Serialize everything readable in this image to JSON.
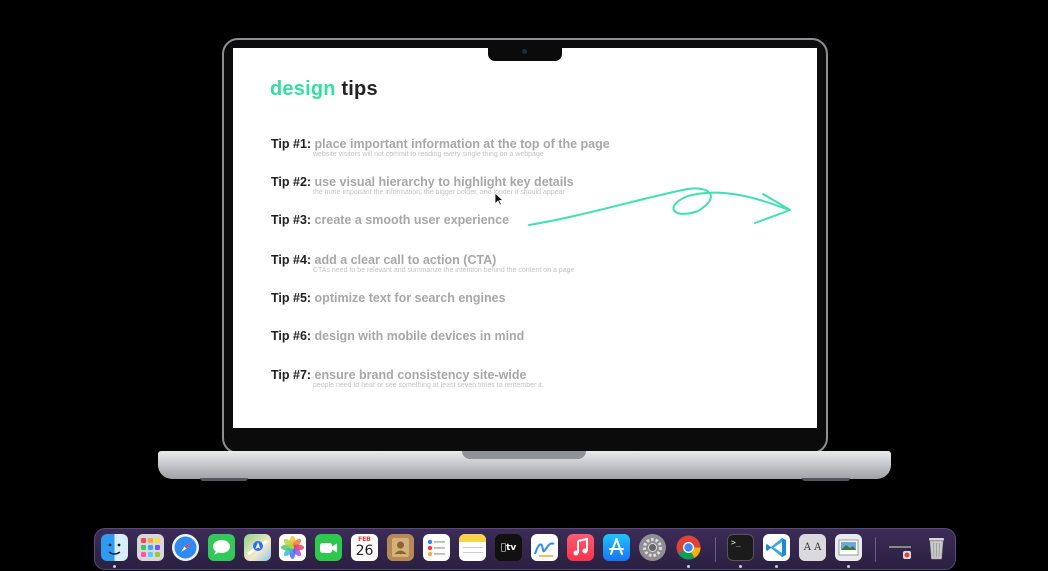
{
  "slide": {
    "title_accent": "design",
    "title_rest": "tips",
    "tips": [
      {
        "label": "Tip #1:",
        "text": "place important information at the top of the page",
        "sub": "website visitors will not commit to reading every single thing on a webpage"
      },
      {
        "label": "Tip #2:",
        "text": "use visual hierarchy to highlight key details",
        "sub": "the more important the information, the bigger bolder, and louder it should appear"
      },
      {
        "label": "Tip #3:",
        "text": "create a smooth user experience",
        "sub": ""
      },
      {
        "label": "Tip #4:",
        "text": "add a clear call to action (CTA)",
        "sub": "CTAs need to be relevant and summarize the intention behind the content on a page"
      },
      {
        "label": "Tip #5:",
        "text": "optimize text for search engines",
        "sub": ""
      },
      {
        "label": "Tip #6:",
        "text": "design with mobile devices in mind",
        "sub": ""
      },
      {
        "label": "Tip #7:",
        "text": "ensure brand consistency site-wide",
        "sub": "people need to hear or see something at least seven times to remember it."
      }
    ],
    "annotation_color": "#3fe0b2",
    "accent_color": "#34e0a0"
  },
  "dock": {
    "apps": [
      {
        "name": "finder-icon",
        "running": true
      },
      {
        "name": "launchpad-icon",
        "running": false
      },
      {
        "name": "safari-icon",
        "running": false
      },
      {
        "name": "messages-icon",
        "running": false
      },
      {
        "name": "maps-icon",
        "running": false
      },
      {
        "name": "photos-icon",
        "running": false
      },
      {
        "name": "facetime-icon",
        "running": false
      },
      {
        "name": "calendar-icon",
        "running": false
      },
      {
        "name": "contacts-icon",
        "running": false
      },
      {
        "name": "reminders-icon",
        "running": false
      },
      {
        "name": "notes-icon",
        "running": false
      },
      {
        "name": "tv-icon",
        "running": false
      },
      {
        "name": "freeform-icon",
        "running": false
      },
      {
        "name": "music-icon",
        "running": false
      },
      {
        "name": "app-store-icon",
        "running": false
      },
      {
        "name": "system-settings-icon",
        "running": false
      },
      {
        "name": "chrome-icon",
        "running": true
      },
      {
        "name": "terminal-icon",
        "running": true
      },
      {
        "name": "vscode-icon",
        "running": true
      },
      {
        "name": "font-book-icon",
        "running": false
      },
      {
        "name": "preview-icon",
        "running": true
      },
      {
        "name": "downloads-stack-icon",
        "running": false
      },
      {
        "name": "trash-icon",
        "running": false
      }
    ],
    "calendar_month": "FEB",
    "calendar_day": "26",
    "tv_label": "tv",
    "terminal_prompt": ">_",
    "font_book_label": "A A"
  }
}
